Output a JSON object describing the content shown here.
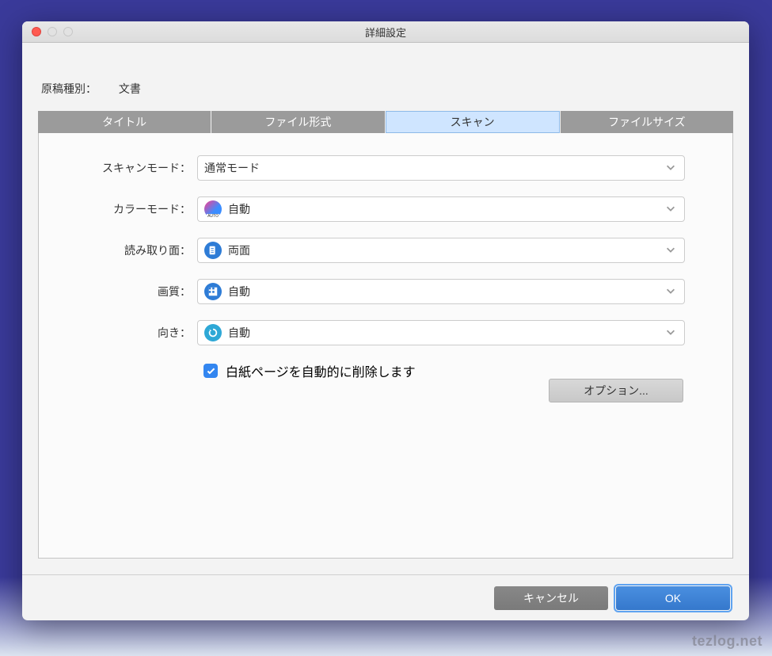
{
  "window": {
    "title": "詳細設定"
  },
  "doctype": {
    "label": "原稿種別：",
    "value": "文書"
  },
  "tabs": [
    {
      "label": "タイトル"
    },
    {
      "label": "ファイル形式"
    },
    {
      "label": "スキャン"
    },
    {
      "label": "ファイルサイズ"
    }
  ],
  "fields": {
    "scanMode": {
      "label": "スキャンモード：",
      "value": "通常モード"
    },
    "colorMode": {
      "label": "カラーモード：",
      "value": "自動"
    },
    "readSide": {
      "label": "読み取り面：",
      "value": "両面"
    },
    "quality": {
      "label": "画質：",
      "value": "自動"
    },
    "orientation": {
      "label": "向き：",
      "value": "自動"
    }
  },
  "checkbox": {
    "label": "白紙ページを自動的に削除します",
    "checked": true
  },
  "optionButton": "オプション...",
  "footer": {
    "cancel": "キャンセル",
    "ok": "OK"
  },
  "watermark": "tezlog.net"
}
